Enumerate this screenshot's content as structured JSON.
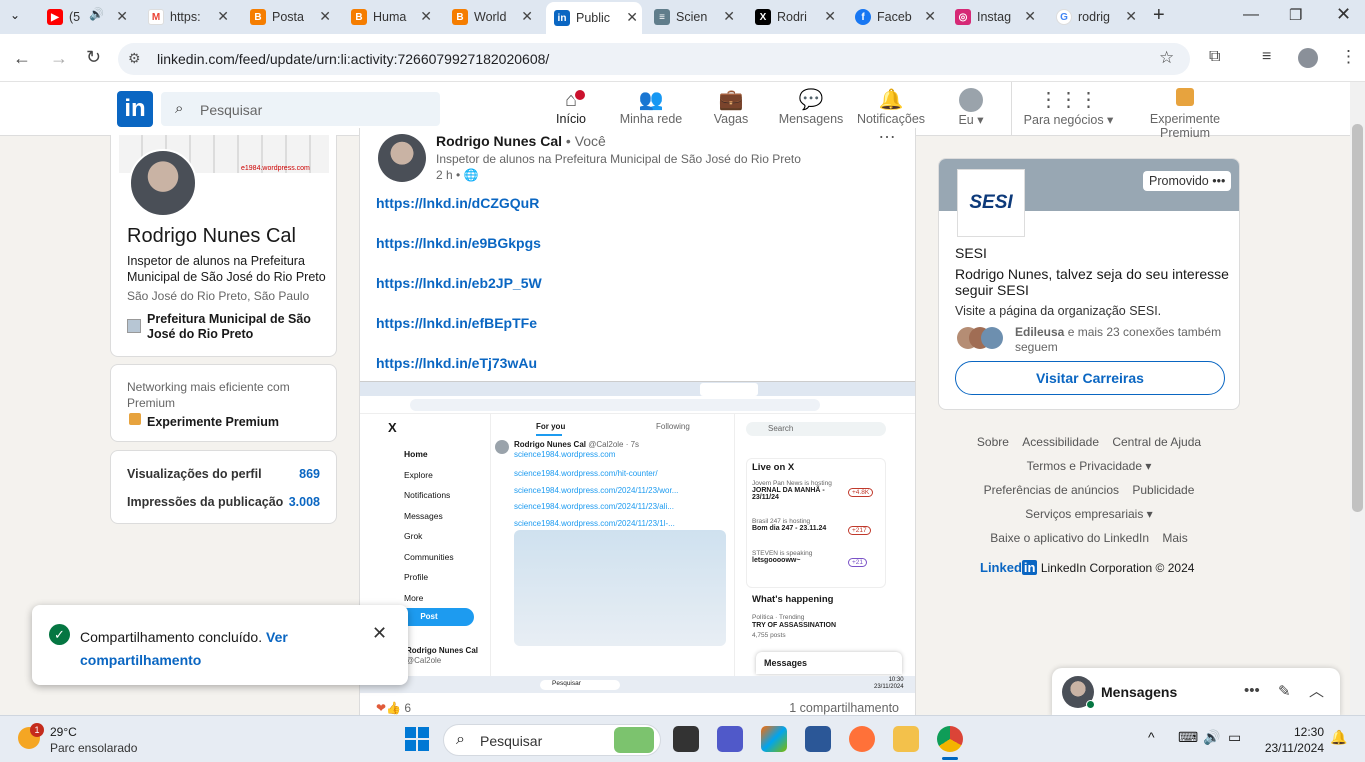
{
  "browser": {
    "tabs": [
      {
        "label": "(5",
        "icon": "youtube-icon",
        "color": "#ff0000"
      },
      {
        "label": "https:",
        "icon": "gmail-icon",
        "color": "#ea4335"
      },
      {
        "label": "Posta",
        "icon": "blogger-icon",
        "color": "#f57d00"
      },
      {
        "label": "Huma",
        "icon": "blogger-icon",
        "color": "#f57d00"
      },
      {
        "label": "World",
        "icon": "blogger-icon",
        "color": "#f57d00"
      },
      {
        "label": "Public",
        "icon": "linkedin-icon",
        "color": "#0a66c2"
      },
      {
        "label": "Scien",
        "icon": "page-icon",
        "color": "#607d8b"
      },
      {
        "label": "Rodri",
        "icon": "x-icon",
        "color": "#000000"
      },
      {
        "label": "Faceb",
        "icon": "facebook-icon",
        "color": "#1877f2"
      },
      {
        "label": "Instag",
        "icon": "instagram-icon",
        "color": "#d62976"
      },
      {
        "label": "rodrig",
        "icon": "google-icon",
        "color": "#4285f4"
      }
    ],
    "url": "linkedin.com/feed/update/urn:li:activity:7266079927182020608/"
  },
  "linkedin": {
    "logo": "in",
    "search_placeholder": "Pesquisar",
    "nav": [
      {
        "label": "Início",
        "icon": "home-icon",
        "badge": ""
      },
      {
        "label": "Minha rede",
        "icon": "network-icon"
      },
      {
        "label": "Vagas",
        "icon": "briefcase-icon"
      },
      {
        "label": "Mensagens",
        "icon": "messaging-icon"
      },
      {
        "label": "Notificações",
        "icon": "bell-icon"
      },
      {
        "label": "Eu ▾",
        "icon": "avatar-icon"
      },
      {
        "label": "Para negócios ▾",
        "icon": "grid-icon"
      },
      {
        "label": "Experimente Premium",
        "icon": "premium-icon"
      }
    ]
  },
  "profile": {
    "name": "Rodrigo Nunes Cal",
    "headline": "Inspetor de alunos na Prefeitura Municipal de São José do Rio Preto",
    "location": "São José do Rio Preto, São Paulo",
    "org": "Prefeitura Municipal de São José do Rio Preto",
    "banner_url": "e1984.wordpress.com",
    "premium_teaser": "Networking mais eficiente com Premium",
    "premium_cta": "Experimente Premium",
    "stats": [
      {
        "label": "Visualizações do perfil",
        "value": "869"
      },
      {
        "label": "Impressões da publicação",
        "value": "3.008"
      }
    ]
  },
  "post": {
    "author": "Rodrigo Nunes Cal",
    "author_suffix": "• Você",
    "headline": "Inspetor de alunos na Prefeitura Municipal de São José do Rio Preto",
    "time": "2 h •",
    "links": [
      "https://lnkd.in/dCZGQuR",
      "https://lnkd.in/e9BGkpgs",
      "https://lnkd.in/eb2JP_5W",
      "https://lnkd.in/efBEpTFe",
      "https://lnkd.in/eTj73wAu"
    ],
    "reactions": "6",
    "shares": "1 compartilhamento"
  },
  "embedded": {
    "x_nav": [
      "Home",
      "Explore",
      "Notifications",
      "Messages",
      "Grok",
      "Communities",
      "Profile",
      "More"
    ],
    "post_btn": "Post",
    "tabs": [
      "For you",
      "Following"
    ],
    "search": "Search",
    "author": "Rodrigo Nunes Cal",
    "handle": "@Cal2ole · 7s",
    "site": "science1984.wordpress.com",
    "links": [
      "science1984.wordpress.com/hit-counter/",
      "science1984.wordpress.com/2024/11/23/wor...",
      "science1984.wordpress.com/2024/11/23/ali...",
      "science1984.wordpress.com/2024/11/23/1l-..."
    ],
    "live_title": "Live on X",
    "live": [
      {
        "host": "Jovem Pan News is hosting",
        "title": "JORNAL DA MANHÃ - 23/11/24",
        "count": "+4.8K"
      },
      {
        "host": "Brasil 247 is hosting",
        "title": "Bom dia 247 - 23.11.24",
        "count": "+217"
      },
      {
        "host": "STEVEN is speaking",
        "title": "letsgooooww~",
        "count": "+21"
      }
    ],
    "happening_title": "What's happening",
    "trend_cat": "Política · Trending",
    "trend": "TRY OF ASSASSINATION",
    "trend_posts": "4,755 posts",
    "messages": "Messages",
    "footer_name": "Rodrigo Nunes Cal",
    "footer_handle": "@Cal2ole",
    "taskbar_search": "Pesquisar",
    "taskbar_time": "10:30",
    "taskbar_date": "23/11/2024"
  },
  "ad": {
    "label": "Promovido",
    "logo": "SESI",
    "company": "SESI",
    "message": "Rodrigo Nunes, talvez seja do seu interesse seguir SESI",
    "sub": "Visite a página da organização SESI.",
    "connections_name": "Edileusa",
    "connections_rest": " e mais 23 conexões também seguem",
    "cta": "Visitar Carreiras"
  },
  "footer": {
    "links": [
      "Sobre",
      "Acessibilidade",
      "Central de Ajuda",
      "Termos e Privacidade ▾",
      "Preferências de anúncios",
      "Publicidade",
      "Serviços empresariais ▾",
      "Baixe o aplicativo do LinkedIn",
      "Mais"
    ],
    "brand": "Linked",
    "brand_in": "in",
    "copyright": "LinkedIn Corporation © 2024"
  },
  "toast": {
    "message": "Compartilhamento concluído.",
    "link": "Ver compartilhamento"
  },
  "messaging": {
    "label": "Mensagens"
  },
  "taskbar": {
    "weather_temp": "29°C",
    "weather_desc": "Parc ensolarado",
    "weather_badge": "1",
    "search": "Pesquisar",
    "time": "12:30",
    "date": "23/11/2024"
  }
}
